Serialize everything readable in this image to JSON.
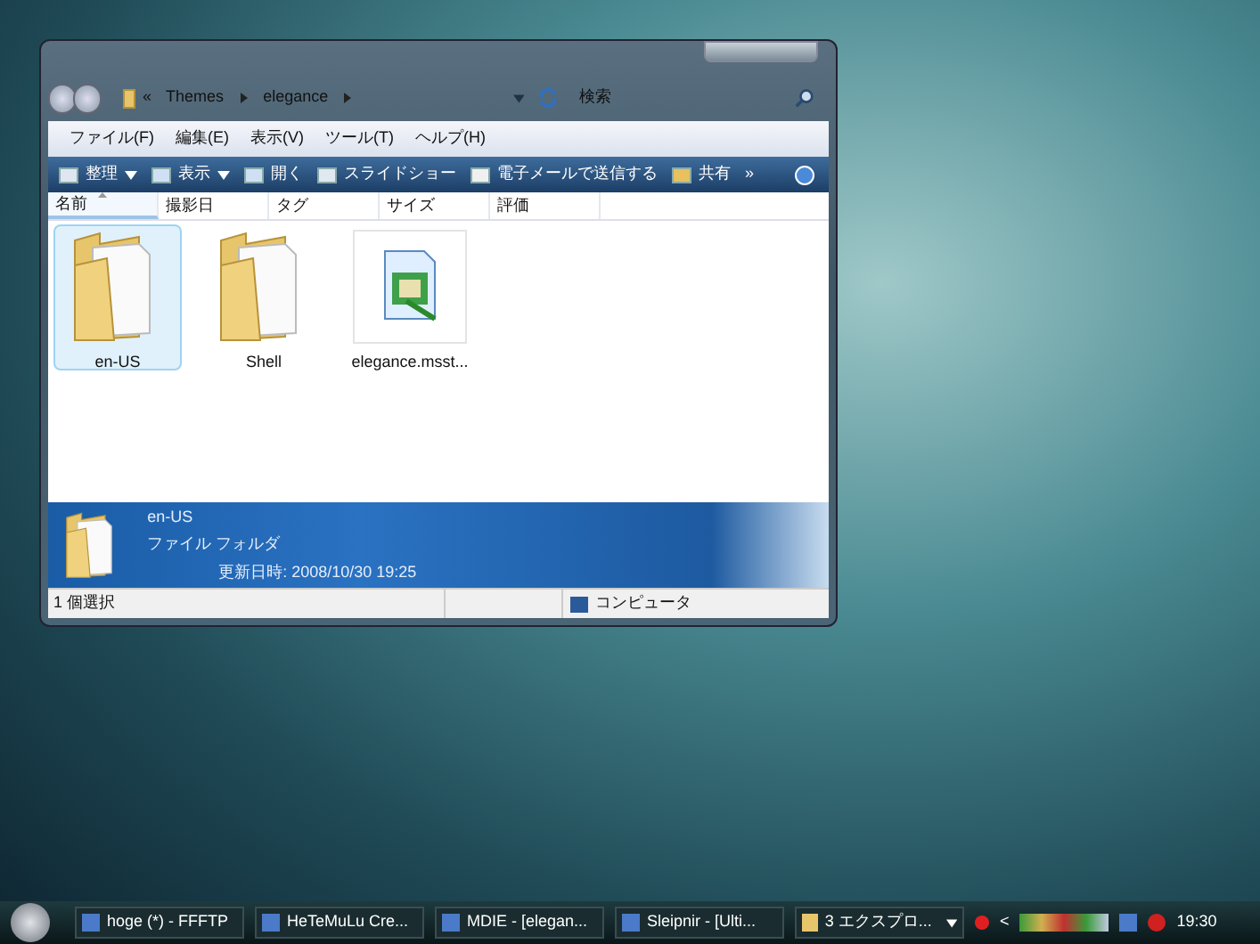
{
  "window": {
    "address": {
      "overflow": "«",
      "segments": [
        "Themes",
        "elegance"
      ]
    },
    "search": {
      "placeholder": "検索"
    },
    "menu": [
      "ファイル(F)",
      "編集(E)",
      "表示(V)",
      "ツール(T)",
      "ヘルプ(H)"
    ],
    "toolbar": [
      {
        "label": "整理",
        "kind": "dropdown"
      },
      {
        "label": "表示",
        "kind": "dropdown"
      },
      {
        "label": "開く",
        "kind": "plain"
      },
      {
        "label": "スライドショー",
        "kind": "plain"
      },
      {
        "label": "電子メールで送信する",
        "kind": "plain"
      },
      {
        "label": "共有",
        "kind": "plain"
      }
    ],
    "toolbar_more": "»",
    "columns": [
      {
        "label": "名前",
        "sorted": true
      },
      {
        "label": "撮影日",
        "sorted": false
      },
      {
        "label": "タグ",
        "sorted": false
      },
      {
        "label": "サイズ",
        "sorted": false
      },
      {
        "label": "評価",
        "sorted": false
      }
    ],
    "items": [
      {
        "name": "en-US",
        "kind": "folder",
        "selected": true
      },
      {
        "name": "Shell",
        "kind": "folder",
        "selected": false
      },
      {
        "name": "elegance.msst...",
        "kind": "file",
        "selected": false
      }
    ],
    "details": {
      "name": "en-US",
      "type": "ファイル フォルダ",
      "modified": "更新日時: 2008/10/30 19:25"
    },
    "status": {
      "selection": "1 個選択",
      "location": "コンピュータ"
    }
  },
  "taskbar": {
    "buttons": [
      {
        "label": "hoge (*) - FFFTP",
        "kind": "single"
      },
      {
        "label": "HeTeMuLu Cre...",
        "kind": "single"
      },
      {
        "label": "MDIE - [elegan...",
        "kind": "single"
      },
      {
        "label": "Sleipnir - [Ulti...",
        "kind": "single"
      },
      {
        "label": "3 エクスプロ...",
        "kind": "group"
      }
    ],
    "tray_expand": "<",
    "clock": "19:30"
  }
}
